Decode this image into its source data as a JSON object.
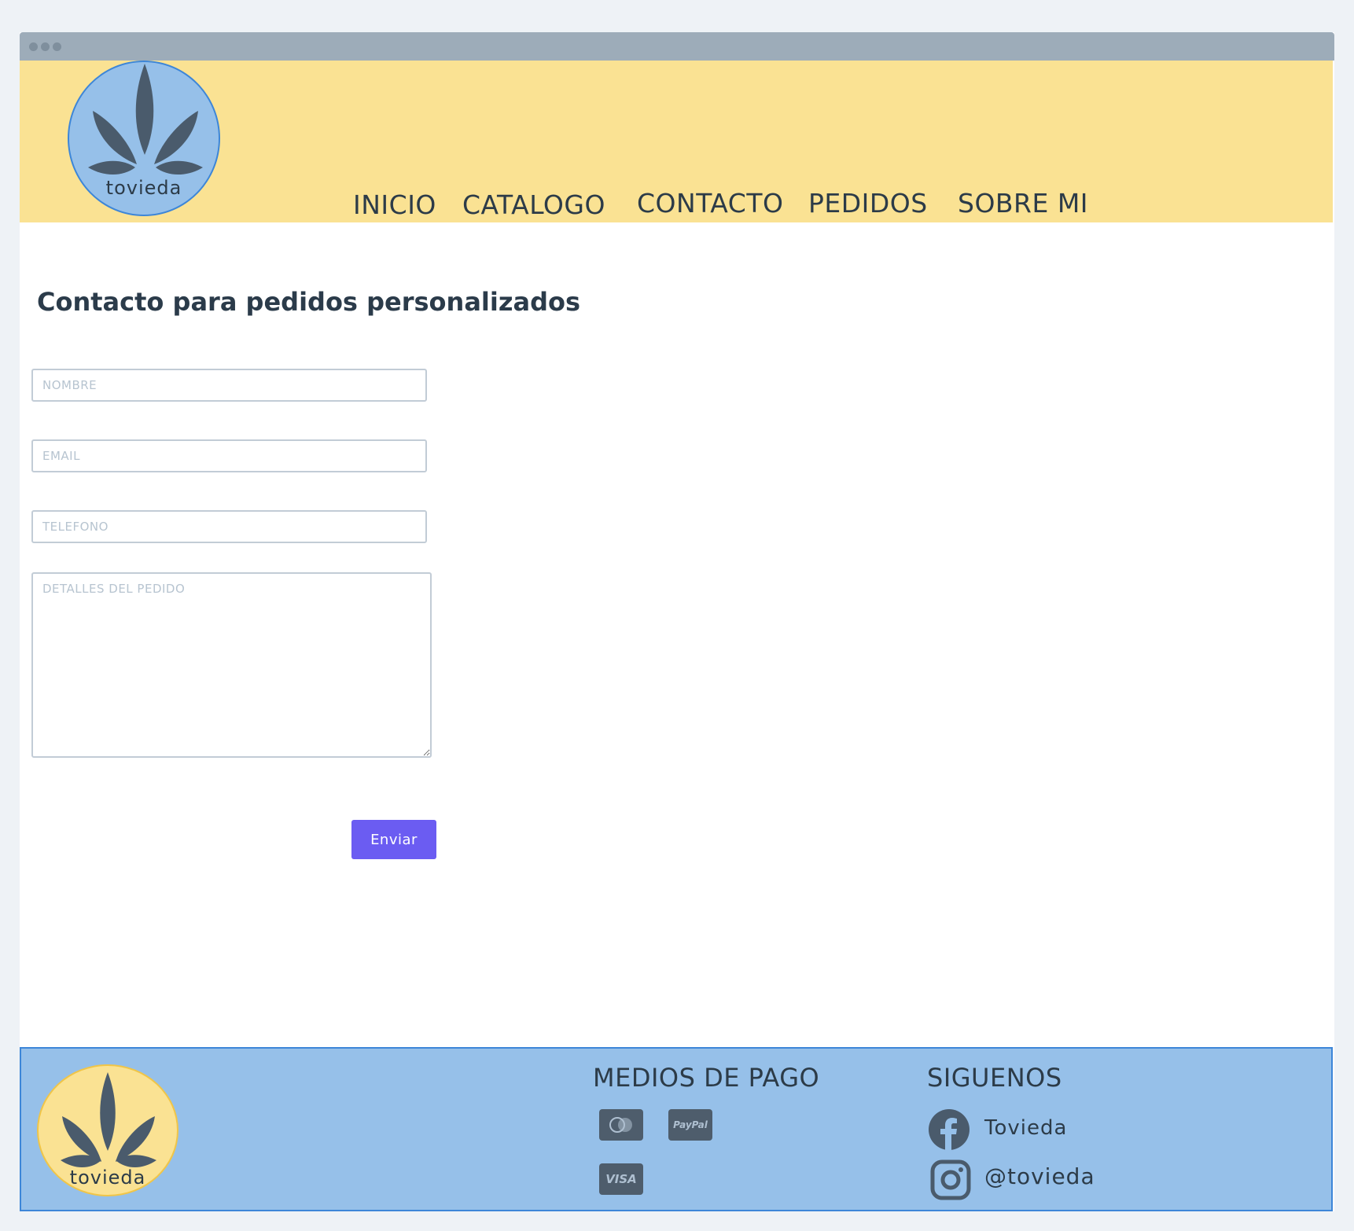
{
  "header": {
    "logo_text": "tovieda",
    "nav": [
      {
        "label": "INICIO"
      },
      {
        "label": "CATALOGO"
      },
      {
        "label": "CONTACTO"
      },
      {
        "label": "PEDIDOS"
      },
      {
        "label": "SOBRE MI"
      }
    ]
  },
  "main": {
    "title": "Contacto para pedidos personalizados",
    "form": {
      "nombre_placeholder": "NOMBRE",
      "email_placeholder": "EMAIL",
      "telefono_placeholder": "TELEFONO",
      "detalles_placeholder": "DETALLES DEL PEDIDO",
      "submit_label": "Enviar"
    }
  },
  "footer": {
    "logo_text": "tovieda",
    "payments_heading": "MEDIOS DE PAGO",
    "payment_methods": [
      {
        "name": "mastercard-icon"
      },
      {
        "name": "paypal-icon",
        "label": "PayPal"
      },
      {
        "name": "visa-icon",
        "label": "VISA"
      }
    ],
    "social_heading": "SIGUENOS",
    "social": [
      {
        "icon": "facebook-icon",
        "label": "Tovieda"
      },
      {
        "icon": "instagram-icon",
        "label": "@tovieda"
      }
    ]
  },
  "colors": {
    "header_bg": "#fae293",
    "footer_bg": "#96c0e9",
    "accent": "#6b5cf2",
    "text": "#2c3b48"
  }
}
